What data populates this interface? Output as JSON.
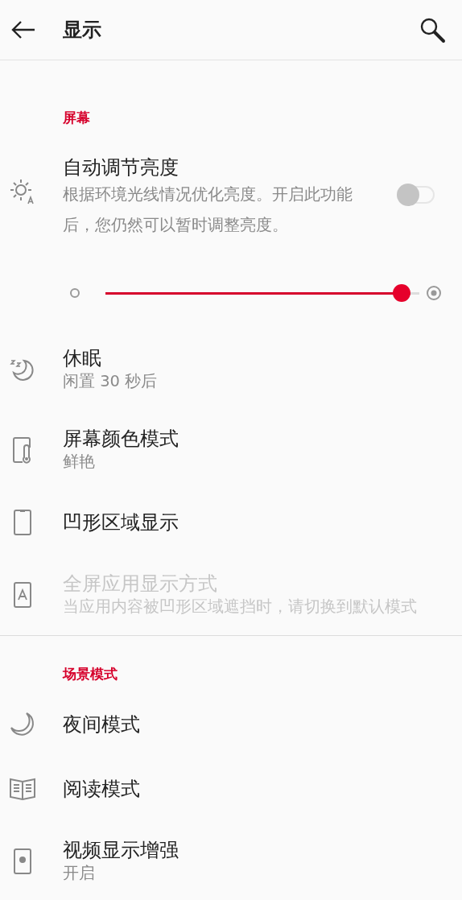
{
  "header": {
    "title": "显示"
  },
  "sections": [
    {
      "title": "屏幕",
      "items": [
        {
          "kind": "toggle",
          "title": "自动调节亮度",
          "subtitle": "根据环境光线情况优化亮度。开启此功能后，您仍然可以暂时调整亮度。",
          "on": false,
          "disabled": false
        },
        {
          "kind": "slider",
          "level": 0.97
        },
        {
          "kind": "plain",
          "title": "休眠",
          "subtitle": "闲置 30 秒后",
          "disabled": false
        },
        {
          "kind": "plain",
          "title": "屏幕颜色模式",
          "subtitle": "鲜艳",
          "disabled": false
        },
        {
          "kind": "plain",
          "title": "凹形区域显示",
          "disabled": false
        },
        {
          "kind": "plain",
          "title": "全屏应用显示方式",
          "subtitle": "当应用内容被凹形区域遮挡时，请切换到默认模式",
          "disabled": true
        }
      ]
    },
    {
      "title": "场景模式",
      "items": [
        {
          "kind": "plain",
          "title": "夜间模式",
          "disabled": false
        },
        {
          "kind": "plain",
          "title": "阅读模式",
          "disabled": false
        },
        {
          "kind": "plain",
          "title": "视频显示增强",
          "subtitle": "开启",
          "disabled": false
        }
      ]
    }
  ]
}
